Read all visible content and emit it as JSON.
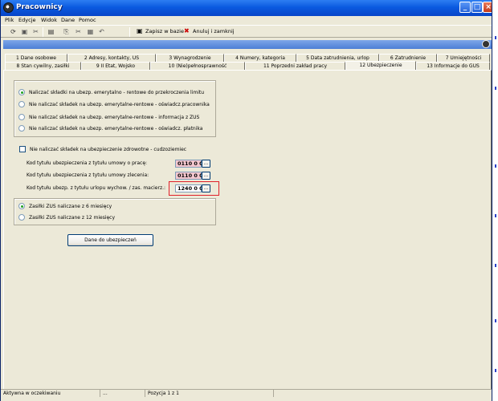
{
  "window": {
    "title": "Pracownicy"
  },
  "menu": [
    "Plik",
    "Edycje",
    "Widok",
    "Dane",
    "Pomoc"
  ],
  "toolbar": {
    "save_label": "Zapisz w bazie",
    "cancel_label": "Anuluj i zamknij"
  },
  "tabs_row1": [
    "1 Dane osobowe",
    "2 Adresy, kontakty, US",
    "3 Wynagrodzenie",
    "4 Numery, kategoria",
    "5 Data zatrudnienia, urlop",
    "6 Zatrudnienie",
    "7 Umiejętności"
  ],
  "tabs_row2": [
    "8 Stan cywilny, zasiłki",
    "9 II Etat, Wojsko",
    "10 (Nie)pełnosprawność",
    "11 Poprzedni zakład pracy",
    "12 Ubezpieczenie",
    "13 Informacje do GUS"
  ],
  "contribution_options": [
    "Naliczać składki na ubezp. emerytalno - rentowe do przekroczenia limitu",
    "Nie naliczać składek na ubezp. emerytalne-rentowe - oświadcz.pracownika",
    "Nie naliczać składek na ubezp. emerytalne-rentowe - informacja z ZUS",
    "Nie naliczać składek na ubezp. emerytalne-rentowe - oświadcz. płatnika"
  ],
  "health_checkbox_label": "Nie naliczać składek na ubezpieczenie zdrowotne - cudzoziemiec",
  "codes": [
    {
      "label": "Kod tytułu ubezpieczenia  z tytułu umowy o pracę:",
      "value": "0110 0 0"
    },
    {
      "label": "Kod tytułu ubezpieczenia  z tytułu umowy zlecenia:",
      "value": "0110 0 0"
    },
    {
      "label": "Kod tytułu ubezp.  z tytułu urlopu wychow. / zas. macierz.:",
      "value": "1240 0 0"
    }
  ],
  "dots": "...",
  "zus_options": [
    "Zasiłki ZUS naliczane z 6 miesięcy",
    "Zasiłki ZUS naliczane z 12 miesięcy"
  ],
  "insurance_button_label": "Dane do ubezpieczeń",
  "status": {
    "left": "Aktywna w oczekiwaniu",
    "mid": "...",
    "position": "Pozycja 1 z 1"
  }
}
